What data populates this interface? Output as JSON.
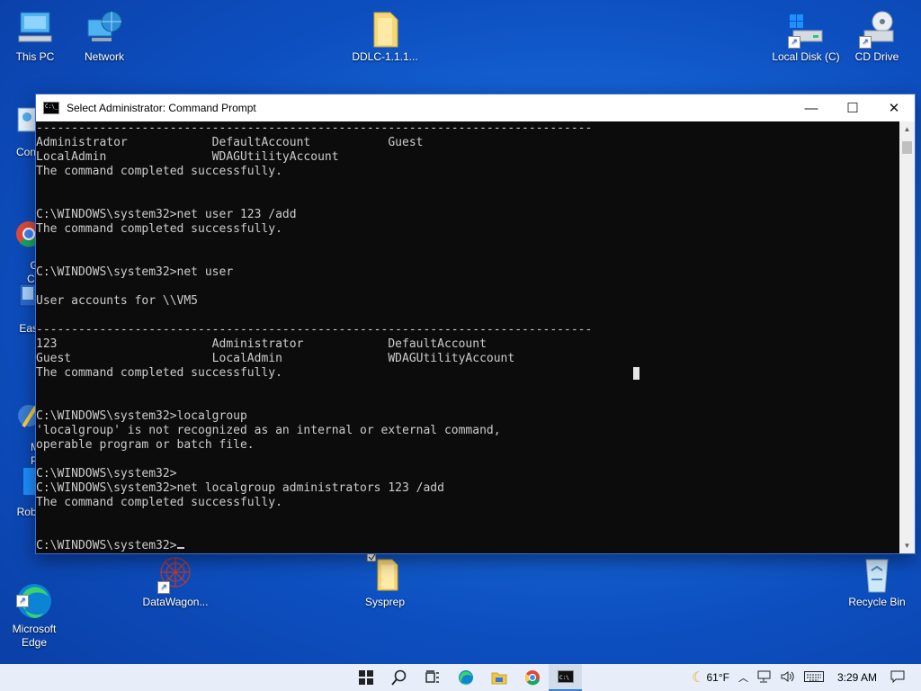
{
  "desktop": {
    "icons": [
      {
        "label": "This PC"
      },
      {
        "label": "Network"
      },
      {
        "label": "DDLC-1.1.1..."
      },
      {
        "label": "Local Disk (C)"
      },
      {
        "label": "CD Drive"
      },
      {
        "label": "Contro"
      },
      {
        "label": "Goo\nChro"
      },
      {
        "label": "EasyB"
      },
      {
        "label": "Mini\nPart"
      },
      {
        "label": "Roblox"
      },
      {
        "label": "Microsoft\nEdge"
      },
      {
        "label": "DataWagon..."
      },
      {
        "label": "Sysprep"
      },
      {
        "label": "Recycle Bin"
      }
    ]
  },
  "window": {
    "title": "Select Administrator: Command Prompt",
    "minimize": "—",
    "maximize": "☐",
    "close": "✕",
    "console_lines": [
      "-------------------------------------------------------------------------------",
      "Administrator            DefaultAccount           Guest",
      "LocalAdmin               WDAGUtilityAccount",
      "The command completed successfully.",
      "",
      "",
      "C:\\WINDOWS\\system32>net user 123 /add",
      "The command completed successfully.",
      "",
      "",
      "C:\\WINDOWS\\system32>net user",
      "",
      "User accounts for \\\\VM5",
      "",
      "-------------------------------------------------------------------------------",
      "123                      Administrator            DefaultAccount",
      "Guest                    LocalAdmin               WDAGUtilityAccount",
      "The command completed successfully.",
      "",
      "",
      "C:\\WINDOWS\\system32>localgroup",
      "'localgroup' is not recognized as an internal or external command,",
      "operable program or batch file.",
      "",
      "C:\\WINDOWS\\system32>",
      "C:\\WINDOWS\\system32>net localgroup administrators 123 /add",
      "The command completed successfully.",
      "",
      "",
      "C:\\WINDOWS\\system32>"
    ]
  },
  "taskbar": {
    "weather": "61°F",
    "time": "3:29 AM",
    "start_icon": "windows-logo",
    "search_icon": "search",
    "taskview_icon": "task-view",
    "edge_icon": "edge",
    "explorer_icon": "folder",
    "chrome_icon": "chrome",
    "cmd_icon": "command-prompt"
  },
  "colors": {
    "desktop_blue": "#1769db",
    "console_bg": "#0c0c0c",
    "console_text": "#cccccc",
    "taskbar_bg": "#e7eef9"
  }
}
